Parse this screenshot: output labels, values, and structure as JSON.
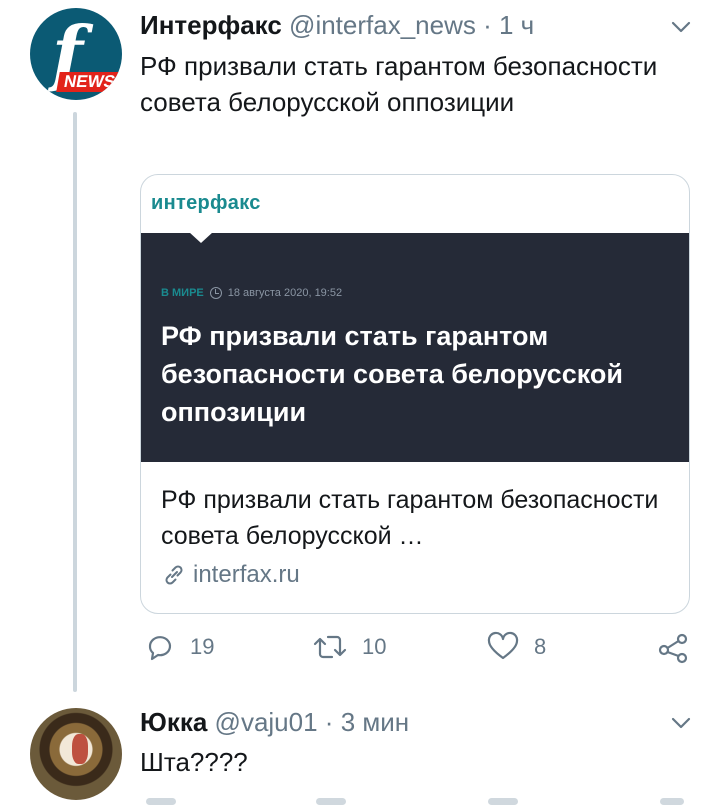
{
  "tweet": {
    "author_name": "Интерфакс",
    "author_handle": "@interfax_news",
    "separator": "·",
    "time": "1 ч",
    "avatar_letter": "f",
    "avatar_badge": "NEWS",
    "text": "РФ призвали стать гарантом безопасности совета белорусской оппозиции",
    "card": {
      "brand": "интерфакс",
      "image_category": "В МИРЕ",
      "image_date": "18 августа 2020, 19:52",
      "image_headline": "РФ призвали стать гарантом безопасности совета белорусской оппозиции",
      "title": "РФ призвали стать гарантом безопасности совета белорусской …",
      "link": "interfax.ru"
    },
    "actions": {
      "replies": "19",
      "retweets": "10",
      "likes": "8"
    }
  },
  "reply": {
    "author_name": "Юкка",
    "author_handle": "@vaju01",
    "separator": "·",
    "time": "3 мин",
    "text": "Шта????"
  },
  "colors": {
    "accent": "#1a8a8f",
    "muted": "#657786",
    "card_dark": "#252a37",
    "badge_red": "#e2231a"
  }
}
